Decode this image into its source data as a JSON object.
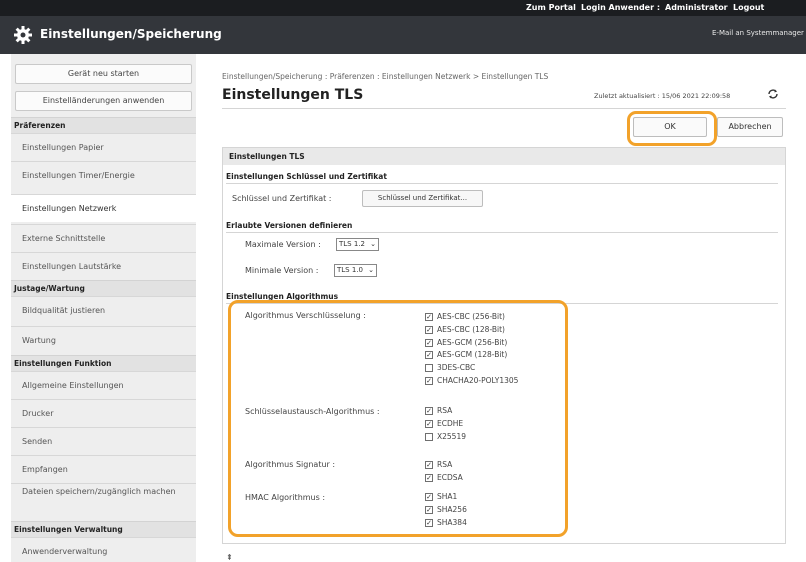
{
  "topbar": {
    "portal_label": "Zum Portal",
    "login_label": "Login Anwender :",
    "user_name": "Administrator",
    "logout_label": "Logout"
  },
  "header": {
    "title": "Einstellungen/Speicherung",
    "email_button": "E-Mail an Systemmanager",
    "icon": "gear-icon"
  },
  "sidebar": {
    "restart_button": "Gerät neu starten",
    "apply_button": "Einstelländerungen anwenden",
    "sections": [
      {
        "title": "Präferenzen",
        "items": [
          "Einstellungen Papier",
          "Einstellungen Timer/Energie",
          "Einstellungen Netzwerk",
          "Externe Schnittstelle",
          "Einstellungen Lautstärke"
        ]
      },
      {
        "title": "Justage/Wartung",
        "items": [
          "Bildqualität justieren",
          "Wartung"
        ]
      },
      {
        "title": "Einstellungen Funktion",
        "items": [
          "Allgemeine Einstellungen",
          "Drucker",
          "Senden",
          "Empfangen",
          "Dateien speichern/zugänglich machen"
        ]
      },
      {
        "title": "Einstellungen Verwaltung",
        "items": [
          "Anwenderverwaltung"
        ]
      }
    ],
    "active_item": "Einstellungen Netzwerk"
  },
  "main": {
    "breadcrumb": "Einstellungen/Speicherung : Präferenzen : Einstellungen Netzwerk > Einstellungen TLS",
    "page_title": "Einstellungen TLS",
    "last_updated": "Zuletzt aktualisiert : 15/06 2021 22:09:58",
    "ok_button": "OK",
    "cancel_button": "Abbrechen",
    "panel_title": "Einstellungen TLS",
    "key_section": {
      "title": "Einstellungen Schlüssel und Zertifikat",
      "label": "Schlüssel und Zertifikat :",
      "button": "Schlüssel und Zertifikat..."
    },
    "version_section": {
      "title": "Erlaubte Versionen definieren",
      "max_label": "Maximale Version :",
      "max_value": "TLS 1.2",
      "min_label": "Minimale Version :",
      "min_value": "TLS 1.0"
    },
    "algo_section": {
      "title": "Einstellungen Algorithmus",
      "groups": [
        {
          "label": "Algorithmus Verschlüsselung :",
          "options": [
            {
              "name": "AES-CBC (256-Bit)",
              "checked": true
            },
            {
              "name": "AES-CBC (128-Bit)",
              "checked": true
            },
            {
              "name": "AES-GCM (256-Bit)",
              "checked": true
            },
            {
              "name": "AES-GCM (128-Bit)",
              "checked": true
            },
            {
              "name": "3DES-CBC",
              "checked": false
            },
            {
              "name": "CHACHA20-POLY1305",
              "checked": true
            }
          ]
        },
        {
          "label": "Schlüsselaustausch-Algorithmus :",
          "options": [
            {
              "name": "RSA",
              "checked": true
            },
            {
              "name": "ECDHE",
              "checked": true
            },
            {
              "name": "X25519",
              "checked": false
            }
          ]
        },
        {
          "label": "Algorithmus Signatur :",
          "options": [
            {
              "name": "RSA",
              "checked": true
            },
            {
              "name": "ECDSA",
              "checked": true
            }
          ]
        },
        {
          "label": "HMAC Algorithmus :",
          "options": [
            {
              "name": "SHA1",
              "checked": true
            },
            {
              "name": "SHA256",
              "checked": true
            },
            {
              "name": "SHA384",
              "checked": true
            }
          ]
        }
      ]
    },
    "scroll_top_glyph": "⇞"
  },
  "colors": {
    "highlight": "#f2a22a",
    "topbar": "#1b1d20",
    "titlebar": "#33363b"
  }
}
